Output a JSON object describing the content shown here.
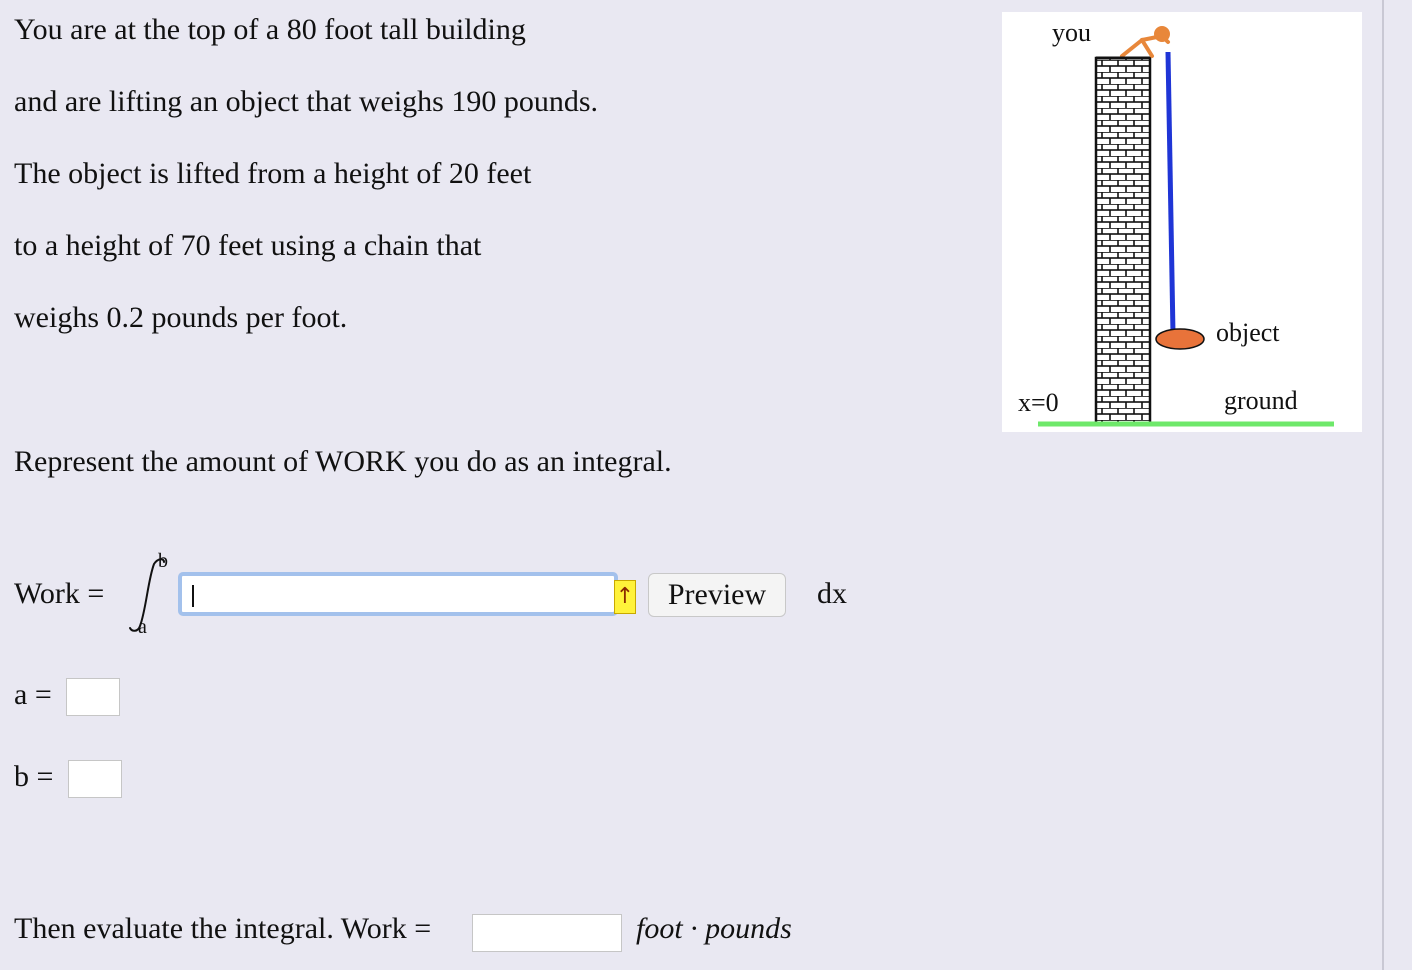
{
  "problem": {
    "lines": [
      "You are at the top of a 80 foot tall building",
      "and are lifting an object that weighs 190 pounds.",
      "The object is lifted from a height of 20 feet",
      "to a height of 70 feet using a chain that",
      "weighs 0.2 pounds per foot."
    ],
    "instruction": "Represent the amount of WORK you do as an integral."
  },
  "figure": {
    "labels": {
      "you": "you",
      "object": "object",
      "x0": "x=0",
      "ground": "ground"
    },
    "colors": {
      "chain": "#1f35d6",
      "object": "#e8733a",
      "person": "#e8873a",
      "ground": "#6ee86a",
      "brick": "#111111"
    }
  },
  "work": {
    "label": "Work =",
    "lower_limit": "a",
    "upper_limit": "b",
    "integrand_value": "",
    "arrow_icon": "↑",
    "preview_label": "Preview",
    "dx": "dx"
  },
  "limits": {
    "a_label": "a =",
    "a_value": "",
    "b_label": "b =",
    "b_value": ""
  },
  "evaluate": {
    "label": "Then evaluate the integral. Work =",
    "value": "",
    "units": "foot · pounds"
  }
}
